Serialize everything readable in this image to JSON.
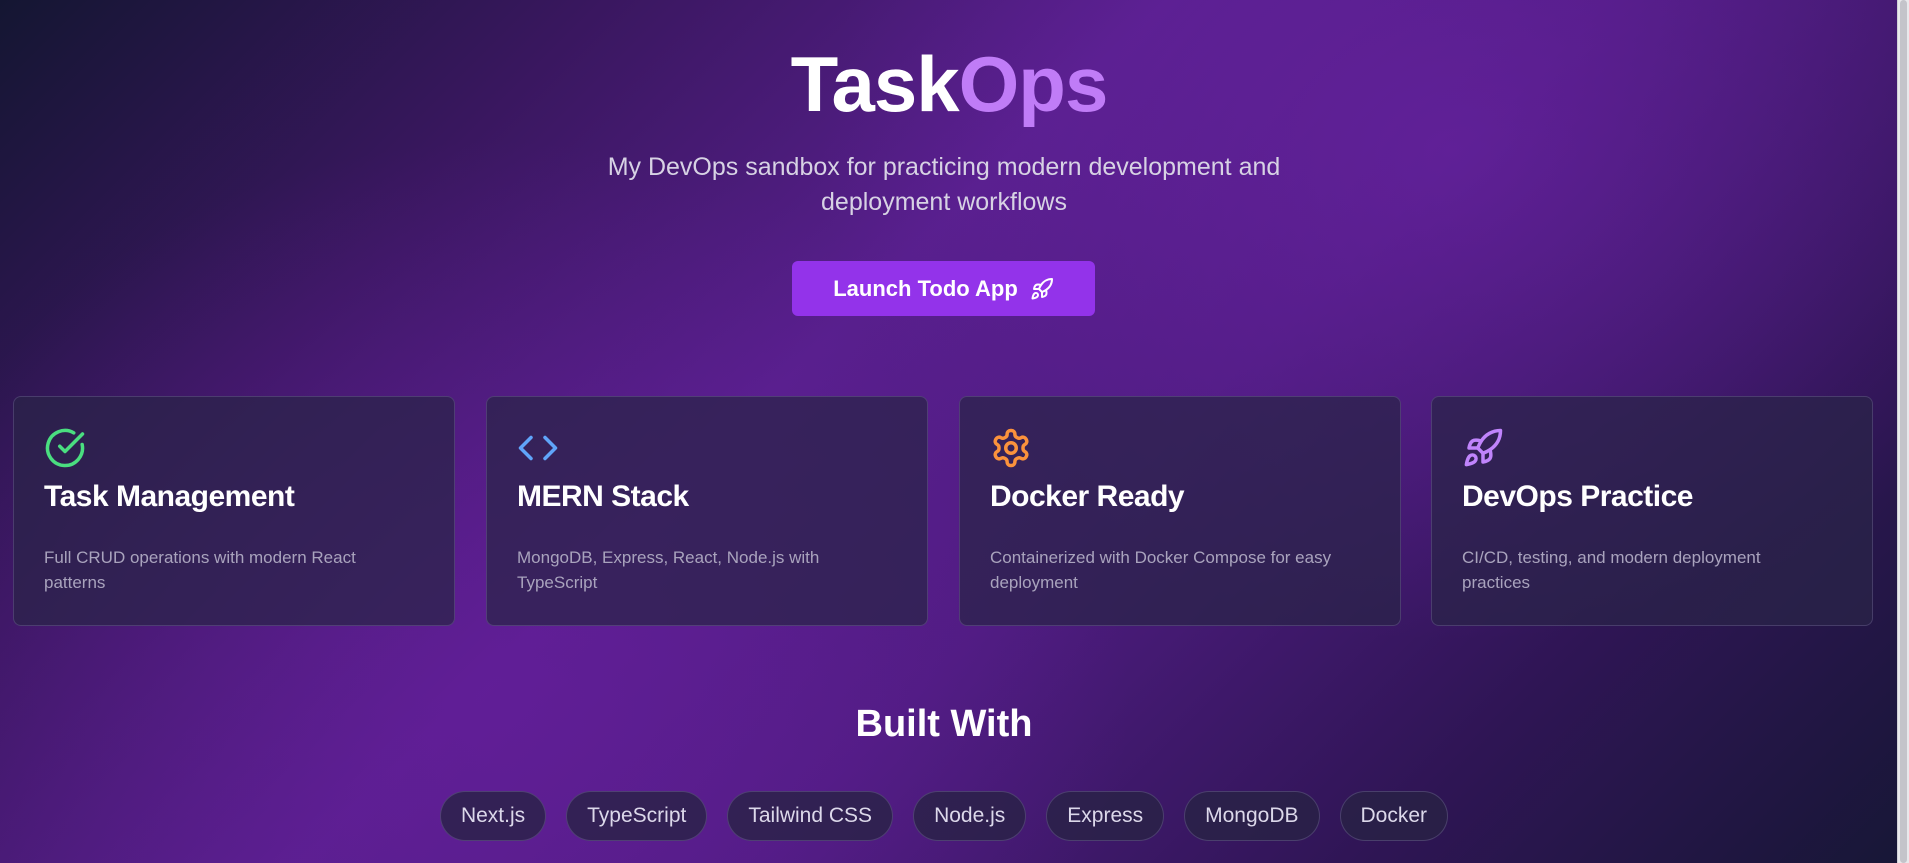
{
  "hero": {
    "title_main": "Task",
    "title_accent": "Ops",
    "subtitle": "My DevOps sandbox for practicing modern development and deployment workflows",
    "launch_button": "Launch Todo App",
    "launch_icon": "rocket-icon"
  },
  "features": [
    {
      "icon": "check-circle-icon",
      "icon_color": "#4ade80",
      "title": "Task Management",
      "description": "Full CRUD operations with modern React patterns"
    },
    {
      "icon": "code-icon",
      "icon_color": "#60a5fa",
      "title": "MERN Stack",
      "description": "MongoDB, Express, React, Node.js with TypeScript"
    },
    {
      "icon": "gear-icon",
      "icon_color": "#fb923c",
      "title": "Docker Ready",
      "description": "Containerized with Docker Compose for easy deployment"
    },
    {
      "icon": "rocket-icon",
      "icon_color": "#c084fc",
      "title": "DevOps Practice",
      "description": "CI/CD, testing, and modern deployment practices"
    }
  ],
  "built_with": {
    "title": "Built With",
    "tags": [
      "Next.js",
      "TypeScript",
      "Tailwind CSS",
      "Node.js",
      "Express",
      "MongoDB",
      "Docker"
    ]
  },
  "colors": {
    "accent": "#c07cf7",
    "button": "#9333ea"
  }
}
